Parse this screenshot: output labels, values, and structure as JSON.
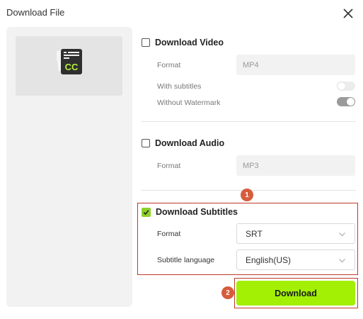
{
  "dialog": {
    "title": "Download File"
  },
  "video": {
    "title": "Download Video",
    "checked": false,
    "format_label": "Format",
    "format_value": "MP4",
    "subtitles_label": "With subtitles",
    "subtitles_on": false,
    "watermark_label": "Without Watermark",
    "watermark_on": true
  },
  "audio": {
    "title": "Download Audio",
    "checked": false,
    "format_label": "Format",
    "format_value": "MP3"
  },
  "subtitles": {
    "title": "Download Subtitles",
    "checked": true,
    "format_label": "Format",
    "format_value": "SRT",
    "language_label": "Subtitle language",
    "language_value": "English(US)"
  },
  "actions": {
    "download_label": "Download"
  },
  "annotations": {
    "badge_1": "1",
    "badge_2": "2"
  },
  "colors": {
    "accent": "#a3f005",
    "check": "#8ed02a",
    "annotation": "#c0392b",
    "badge": "#d65c3c"
  },
  "icons": {
    "thumbnail": "cc-subtitle-file-icon",
    "close": "close-icon",
    "dropdown": "chevron-down-icon"
  }
}
